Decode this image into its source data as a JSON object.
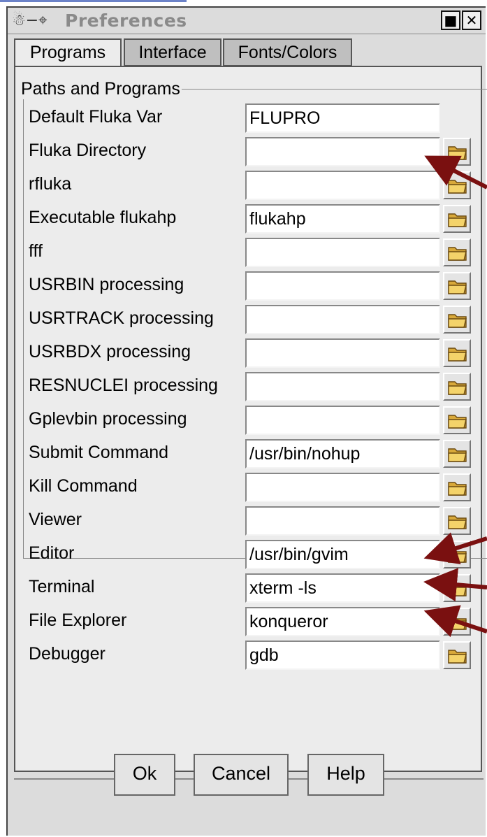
{
  "window": {
    "title": "Preferences",
    "title_icons": "☃−⌖",
    "maximize_glyph": "■",
    "close_glyph": "✕"
  },
  "tabs": [
    {
      "label": "Programs",
      "active": true
    },
    {
      "label": "Interface",
      "active": false
    },
    {
      "label": "Fonts/Colors",
      "active": false
    }
  ],
  "group_title": "Paths and Programs",
  "rows": [
    {
      "label": "Default Fluka Var",
      "value": "FLUPRO",
      "has_browse": false
    },
    {
      "label": "Fluka Directory",
      "value": "",
      "has_browse": true
    },
    {
      "label": "rfluka",
      "value": "",
      "has_browse": true
    },
    {
      "label": "Executable flukahp",
      "value": "flukahp",
      "has_browse": true
    },
    {
      "label": "fff",
      "value": "",
      "has_browse": true
    },
    {
      "label": "USRBIN processing",
      "value": "",
      "has_browse": true
    },
    {
      "label": "USRTRACK processing",
      "value": "",
      "has_browse": true
    },
    {
      "label": "USRBDX processing",
      "value": "",
      "has_browse": true
    },
    {
      "label": "RESNUCLEI processing",
      "value": "",
      "has_browse": true
    },
    {
      "label": "Gplevbin processing",
      "value": "",
      "has_browse": true
    },
    {
      "label": "Submit Command",
      "value": "/usr/bin/nohup",
      "has_browse": true
    },
    {
      "label": "Kill Command",
      "value": "",
      "has_browse": true
    },
    {
      "label": "Viewer",
      "value": "",
      "has_browse": true
    },
    {
      "label": "Editor",
      "value": "/usr/bin/gvim",
      "has_browse": true
    },
    {
      "label": "Terminal",
      "value": "xterm -ls",
      "has_browse": true
    },
    {
      "label": "File Explorer",
      "value": "konqueror",
      "has_browse": true
    },
    {
      "label": "Debugger",
      "value": "gdb",
      "has_browse": true
    }
  ],
  "buttons": {
    "ok": "Ok",
    "cancel": "Cancel",
    "help": "Help"
  },
  "colors": {
    "annotation_arrow": "#7a1010",
    "accent_line": "#6b82c8"
  }
}
